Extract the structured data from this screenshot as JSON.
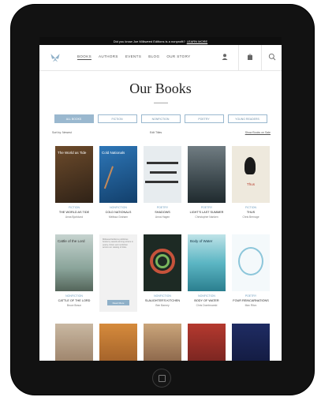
{
  "promo": {
    "text": "Did you know Joe Milkweed Editions is a nonprofit?",
    "link": "LEARN MORE"
  },
  "nav": {
    "items": [
      "Books",
      "Authors",
      "Events",
      "Blog",
      "Our Story"
    ]
  },
  "page": {
    "title": "Our Books"
  },
  "filters": [
    "All Books",
    "Fiction",
    "Nonfiction",
    "Poetry",
    "Young Readers"
  ],
  "sort": {
    "label": "Sort by: Newest",
    "mid": "Edit Titles",
    "right": "Show Books on Sale"
  },
  "books": [
    {
      "category": "Fiction",
      "title": "The World as Tide",
      "author": "Anna Bjorklund"
    },
    {
      "category": "Nonfiction",
      "title": "Cold Nationals",
      "author": "Melissa Graham"
    },
    {
      "category": "Poetry",
      "title": "Shadows",
      "author": "Anna Hagen"
    },
    {
      "category": "Poetry",
      "title": "Light's Last Summer",
      "author": "Christopher Nanken"
    },
    {
      "category": "Fiction",
      "title": "Thus",
      "author": "Chris Bernage"
    },
    {
      "category": "Nonfiction",
      "title": "Cattle of the Lord",
      "author": "Bruce Braun"
    },
    {
      "category": "",
      "title": "",
      "author": ""
    },
    {
      "category": "Nonfiction",
      "title": "Slaughter's Kitchen",
      "author": "Ben Barney"
    },
    {
      "category": "Nonfiction",
      "title": "Body of Water",
      "author": "Chris Dombrowski"
    },
    {
      "category": "Poetry",
      "title": "Four Reincarnations",
      "author": "Max Ritvo"
    }
  ],
  "promo_card": {
    "text": "Milkweed Editions publishes books by award-winning writers in poetry, fiction and nonfiction across our catalog of titles.",
    "button": "Read More"
  }
}
